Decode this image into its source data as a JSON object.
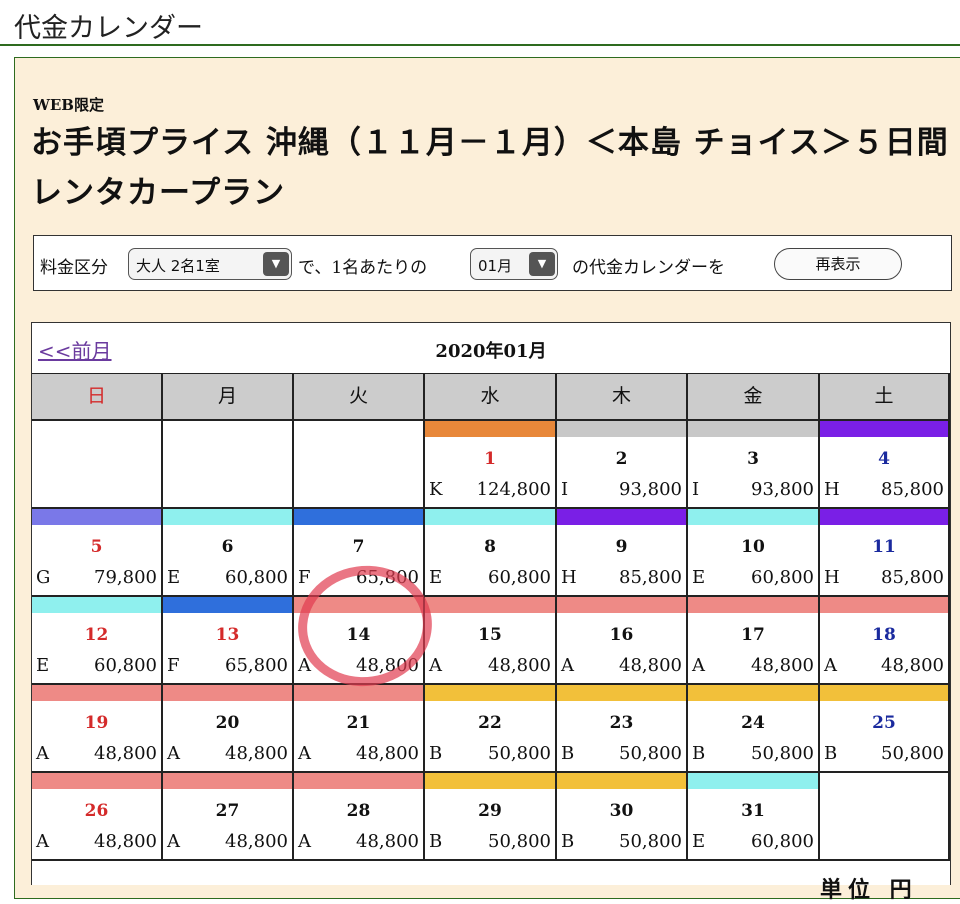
{
  "header": {
    "title": "代金カレンダー"
  },
  "plan": {
    "web_tag": "WEB限定",
    "title": "お手頃プライス 沖縄（１１月－１月）＜本島 チョイス＞５日間レンタカープラン"
  },
  "selector": {
    "prefix": "料金区分",
    "category_value": "大人 2名1室",
    "middle": "で、1名あたりの",
    "month_value": "01月",
    "suffix": "の代金カレンダーを",
    "redisplay_label": "再表示"
  },
  "calendar": {
    "prev_link": "<<前月",
    "month_label": "2020年01月",
    "weekdays": [
      "日",
      "月",
      "火",
      "水",
      "木",
      "金",
      "土"
    ],
    "weeks": [
      [
        null,
        null,
        null,
        {
          "day": "1",
          "code": "K",
          "price": "124,800",
          "color": "#e8883a",
          "red": true
        },
        {
          "day": "2",
          "code": "I",
          "price": "93,800",
          "color": "#c8c8c8"
        },
        {
          "day": "3",
          "code": "I",
          "price": "93,800",
          "color": "#c8c8c8"
        },
        {
          "day": "4",
          "code": "H",
          "price": "85,800",
          "color": "#7a1fe6"
        }
      ],
      [
        {
          "day": "5",
          "code": "G",
          "price": "79,800",
          "color": "#7a78e8"
        },
        {
          "day": "6",
          "code": "E",
          "price": "60,800",
          "color": "#8ff0ee"
        },
        {
          "day": "7",
          "code": "F",
          "price": "65,800",
          "color": "#2f6fdc"
        },
        {
          "day": "8",
          "code": "E",
          "price": "60,800",
          "color": "#8ff0ee"
        },
        {
          "day": "9",
          "code": "H",
          "price": "85,800",
          "color": "#7a1fe6"
        },
        {
          "day": "10",
          "code": "E",
          "price": "60,800",
          "color": "#8ff0ee"
        },
        {
          "day": "11",
          "code": "H",
          "price": "85,800",
          "color": "#7a1fe6"
        }
      ],
      [
        {
          "day": "12",
          "code": "E",
          "price": "60,800",
          "color": "#8ff0ee"
        },
        {
          "day": "13",
          "code": "F",
          "price": "65,800",
          "color": "#2f6fdc",
          "red": true
        },
        {
          "day": "14",
          "code": "A",
          "price": "48,800",
          "color": "#ee8a86"
        },
        {
          "day": "15",
          "code": "A",
          "price": "48,800",
          "color": "#ee8a86"
        },
        {
          "day": "16",
          "code": "A",
          "price": "48,800",
          "color": "#ee8a86"
        },
        {
          "day": "17",
          "code": "A",
          "price": "48,800",
          "color": "#ee8a86"
        },
        {
          "day": "18",
          "code": "A",
          "price": "48,800",
          "color": "#ee8a86"
        }
      ],
      [
        {
          "day": "19",
          "code": "A",
          "price": "48,800",
          "color": "#ee8a86"
        },
        {
          "day": "20",
          "code": "A",
          "price": "48,800",
          "color": "#ee8a86"
        },
        {
          "day": "21",
          "code": "A",
          "price": "48,800",
          "color": "#ee8a86"
        },
        {
          "day": "22",
          "code": "B",
          "price": "50,800",
          "color": "#f2c03a"
        },
        {
          "day": "23",
          "code": "B",
          "price": "50,800",
          "color": "#f2c03a"
        },
        {
          "day": "24",
          "code": "B",
          "price": "50,800",
          "color": "#f2c03a"
        },
        {
          "day": "25",
          "code": "B",
          "price": "50,800",
          "color": "#f2c03a"
        }
      ],
      [
        {
          "day": "26",
          "code": "A",
          "price": "48,800",
          "color": "#ee8a86"
        },
        {
          "day": "27",
          "code": "A",
          "price": "48,800",
          "color": "#ee8a86"
        },
        {
          "day": "28",
          "code": "A",
          "price": "48,800",
          "color": "#ee8a86"
        },
        {
          "day": "29",
          "code": "B",
          "price": "50,800",
          "color": "#f2c03a"
        },
        {
          "day": "30",
          "code": "B",
          "price": "50,800",
          "color": "#f2c03a"
        },
        {
          "day": "31",
          "code": "E",
          "price": "60,800",
          "color": "#8ff0ee"
        },
        null
      ]
    ]
  },
  "footer_partial": "単位 円"
}
